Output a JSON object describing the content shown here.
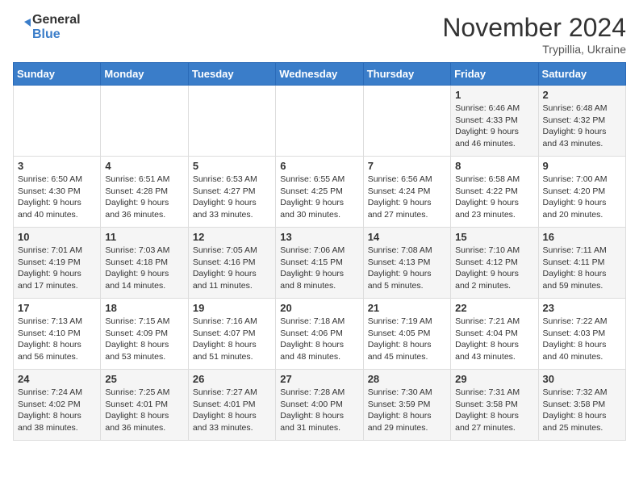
{
  "header": {
    "logo_line1": "General",
    "logo_line2": "Blue",
    "month": "November 2024",
    "location": "Trypillia, Ukraine"
  },
  "days_of_week": [
    "Sunday",
    "Monday",
    "Tuesday",
    "Wednesday",
    "Thursday",
    "Friday",
    "Saturday"
  ],
  "weeks": [
    [
      {
        "day": "",
        "info": ""
      },
      {
        "day": "",
        "info": ""
      },
      {
        "day": "",
        "info": ""
      },
      {
        "day": "",
        "info": ""
      },
      {
        "day": "",
        "info": ""
      },
      {
        "day": "1",
        "info": "Sunrise: 6:46 AM\nSunset: 4:33 PM\nDaylight: 9 hours and 46 minutes."
      },
      {
        "day": "2",
        "info": "Sunrise: 6:48 AM\nSunset: 4:32 PM\nDaylight: 9 hours and 43 minutes."
      }
    ],
    [
      {
        "day": "3",
        "info": "Sunrise: 6:50 AM\nSunset: 4:30 PM\nDaylight: 9 hours and 40 minutes."
      },
      {
        "day": "4",
        "info": "Sunrise: 6:51 AM\nSunset: 4:28 PM\nDaylight: 9 hours and 36 minutes."
      },
      {
        "day": "5",
        "info": "Sunrise: 6:53 AM\nSunset: 4:27 PM\nDaylight: 9 hours and 33 minutes."
      },
      {
        "day": "6",
        "info": "Sunrise: 6:55 AM\nSunset: 4:25 PM\nDaylight: 9 hours and 30 minutes."
      },
      {
        "day": "7",
        "info": "Sunrise: 6:56 AM\nSunset: 4:24 PM\nDaylight: 9 hours and 27 minutes."
      },
      {
        "day": "8",
        "info": "Sunrise: 6:58 AM\nSunset: 4:22 PM\nDaylight: 9 hours and 23 minutes."
      },
      {
        "day": "9",
        "info": "Sunrise: 7:00 AM\nSunset: 4:20 PM\nDaylight: 9 hours and 20 minutes."
      }
    ],
    [
      {
        "day": "10",
        "info": "Sunrise: 7:01 AM\nSunset: 4:19 PM\nDaylight: 9 hours and 17 minutes."
      },
      {
        "day": "11",
        "info": "Sunrise: 7:03 AM\nSunset: 4:18 PM\nDaylight: 9 hours and 14 minutes."
      },
      {
        "day": "12",
        "info": "Sunrise: 7:05 AM\nSunset: 4:16 PM\nDaylight: 9 hours and 11 minutes."
      },
      {
        "day": "13",
        "info": "Sunrise: 7:06 AM\nSunset: 4:15 PM\nDaylight: 9 hours and 8 minutes."
      },
      {
        "day": "14",
        "info": "Sunrise: 7:08 AM\nSunset: 4:13 PM\nDaylight: 9 hours and 5 minutes."
      },
      {
        "day": "15",
        "info": "Sunrise: 7:10 AM\nSunset: 4:12 PM\nDaylight: 9 hours and 2 minutes."
      },
      {
        "day": "16",
        "info": "Sunrise: 7:11 AM\nSunset: 4:11 PM\nDaylight: 8 hours and 59 minutes."
      }
    ],
    [
      {
        "day": "17",
        "info": "Sunrise: 7:13 AM\nSunset: 4:10 PM\nDaylight: 8 hours and 56 minutes."
      },
      {
        "day": "18",
        "info": "Sunrise: 7:15 AM\nSunset: 4:09 PM\nDaylight: 8 hours and 53 minutes."
      },
      {
        "day": "19",
        "info": "Sunrise: 7:16 AM\nSunset: 4:07 PM\nDaylight: 8 hours and 51 minutes."
      },
      {
        "day": "20",
        "info": "Sunrise: 7:18 AM\nSunset: 4:06 PM\nDaylight: 8 hours and 48 minutes."
      },
      {
        "day": "21",
        "info": "Sunrise: 7:19 AM\nSunset: 4:05 PM\nDaylight: 8 hours and 45 minutes."
      },
      {
        "day": "22",
        "info": "Sunrise: 7:21 AM\nSunset: 4:04 PM\nDaylight: 8 hours and 43 minutes."
      },
      {
        "day": "23",
        "info": "Sunrise: 7:22 AM\nSunset: 4:03 PM\nDaylight: 8 hours and 40 minutes."
      }
    ],
    [
      {
        "day": "24",
        "info": "Sunrise: 7:24 AM\nSunset: 4:02 PM\nDaylight: 8 hours and 38 minutes."
      },
      {
        "day": "25",
        "info": "Sunrise: 7:25 AM\nSunset: 4:01 PM\nDaylight: 8 hours and 36 minutes."
      },
      {
        "day": "26",
        "info": "Sunrise: 7:27 AM\nSunset: 4:01 PM\nDaylight: 8 hours and 33 minutes."
      },
      {
        "day": "27",
        "info": "Sunrise: 7:28 AM\nSunset: 4:00 PM\nDaylight: 8 hours and 31 minutes."
      },
      {
        "day": "28",
        "info": "Sunrise: 7:30 AM\nSunset: 3:59 PM\nDaylight: 8 hours and 29 minutes."
      },
      {
        "day": "29",
        "info": "Sunrise: 7:31 AM\nSunset: 3:58 PM\nDaylight: 8 hours and 27 minutes."
      },
      {
        "day": "30",
        "info": "Sunrise: 7:32 AM\nSunset: 3:58 PM\nDaylight: 8 hours and 25 minutes."
      }
    ]
  ]
}
